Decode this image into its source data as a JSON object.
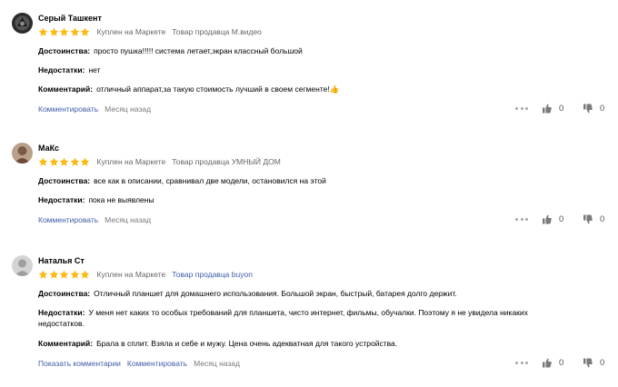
{
  "reviews": [
    {
      "author": "Серый Ташкент",
      "avatar_icon": "dark-emblem-avatar",
      "rating": 5,
      "purchase": "Куплен на Маркете",
      "seller": "Товар продавца М.видео",
      "fields": [
        {
          "label": "Достоинства:",
          "text": "просто пушка!!!!! система летает,экран классный большой"
        },
        {
          "label": "Недостатки:",
          "text": "нет"
        },
        {
          "label": "Комментарий:",
          "text": "отличный аппарат,за такую стоимость лучший в своем сегменте!👍"
        }
      ],
      "comment_link": "Комментировать",
      "date": "Месяц назад",
      "likes": "0",
      "dislikes": "0"
    },
    {
      "author": "МаКс",
      "avatar_icon": "person-photo-avatar",
      "rating": 5,
      "purchase": "Куплен на Маркете",
      "seller": "Товар продавца УМНЫЙ ДОМ",
      "fields": [
        {
          "label": "Достоинства:",
          "text": "все как в описании, сравнивал две модели, остановился на этой"
        },
        {
          "label": "Недостатки:",
          "text": "пока не выявлены"
        }
      ],
      "comment_link": "Комментировать",
      "date": "Месяц назад",
      "likes": "0",
      "dislikes": "0"
    },
    {
      "author": "Наталья Ст",
      "avatar_icon": "default-user-avatar",
      "rating": 5,
      "purchase": "Куплен на Маркете",
      "seller": "Товар продавца buyon",
      "fields": [
        {
          "label": "Достоинства:",
          "text": "Отличный планшет для домашнего использования. Большой экран, быстрый, батарея долго держит."
        },
        {
          "label": "Недостатки:",
          "text": "У меня нет каких то особых требований для планшета, чисто интернет, фильмы, обучалки. Поэтому я не увидела никаких"
        },
        {
          "label": "",
          "text": "недостатков."
        },
        {
          "label": "Комментарий:",
          "text": "Брала в сплит. Взяла и себе и мужу. Цена очень адекватная для такого устройства."
        }
      ],
      "show_comments_link": "Показать комментарии",
      "comment_link": "Комментировать",
      "date": "Месяц назад",
      "likes": "0",
      "dislikes": "0"
    }
  ],
  "colors": {
    "star": "#fdb913",
    "link": "#3f5fa8",
    "meta": "#666666",
    "seller_link": "#3f5fa8"
  },
  "icons": {
    "star": "star-icon",
    "more": "more-dots-icon",
    "like": "thumbs-up-icon",
    "dislike": "thumbs-down-icon"
  }
}
